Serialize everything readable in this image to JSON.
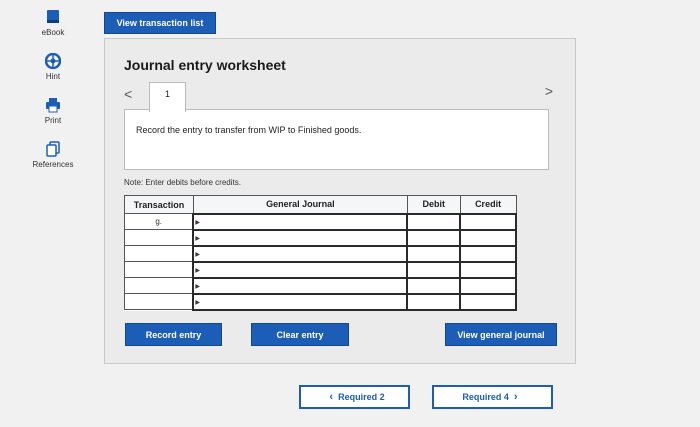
{
  "sidebar": {
    "items": [
      {
        "label": "eBook",
        "icon": "ebook-icon"
      },
      {
        "label": "Hint",
        "icon": "hint-icon"
      },
      {
        "label": "Print",
        "icon": "print-icon"
      },
      {
        "label": "References",
        "icon": "references-icon"
      }
    ]
  },
  "top_button": "View transaction list",
  "worksheet": {
    "title": "Journal entry worksheet",
    "current_tab": "1",
    "prev_glyph": "<",
    "next_glyph": ">",
    "instruction": "Record the entry to transfer from WIP to Finished goods.",
    "note": "Note: Enter debits before credits."
  },
  "table": {
    "headers": [
      "Transaction",
      "General Journal",
      "Debit",
      "Credit"
    ],
    "rows": [
      {
        "transaction": "g.",
        "account": "",
        "debit": "",
        "credit": ""
      },
      {
        "transaction": "",
        "account": "",
        "debit": "",
        "credit": ""
      },
      {
        "transaction": "",
        "account": "",
        "debit": "",
        "credit": ""
      },
      {
        "transaction": "",
        "account": "",
        "debit": "",
        "credit": ""
      },
      {
        "transaction": "",
        "account": "",
        "debit": "",
        "credit": ""
      },
      {
        "transaction": "",
        "account": "",
        "debit": "",
        "credit": ""
      }
    ]
  },
  "buttons": {
    "record": "Record entry",
    "clear": "Clear entry",
    "view_journal": "View general journal"
  },
  "bottom_nav": {
    "prev_label": "Required 2",
    "next_label": "Required 4"
  },
  "colors": {
    "accent": "#1c5eb7"
  }
}
